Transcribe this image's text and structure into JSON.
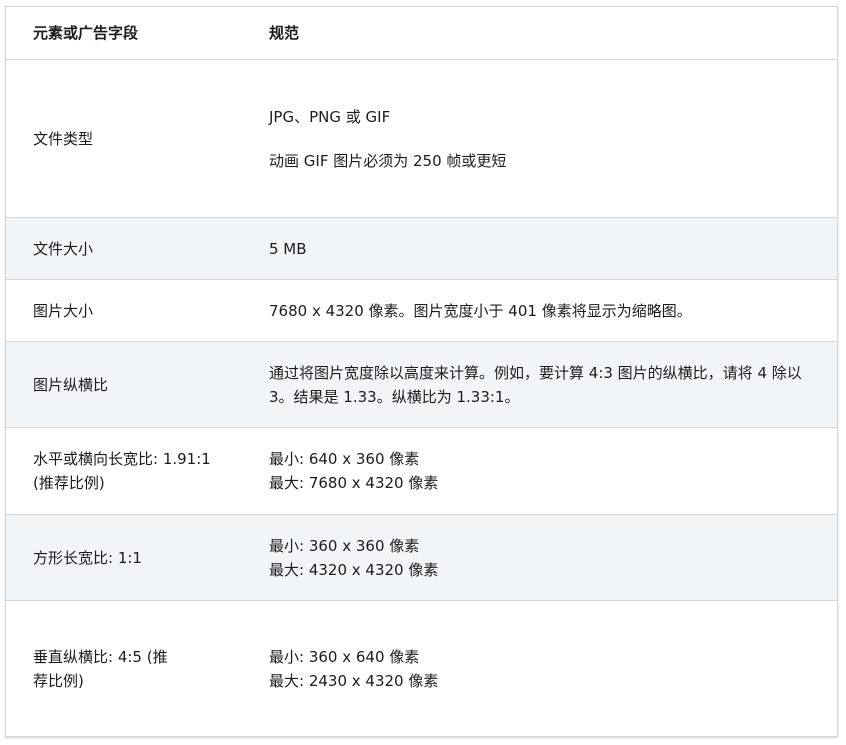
{
  "header": {
    "col1": "元素或广告字段",
    "col2": "规范"
  },
  "rows": [
    {
      "field": "文件类型",
      "spec": [
        "JPG、PNG 或 GIF",
        "动画 GIF 图片必须为 250 帧或更短"
      ]
    },
    {
      "field": "文件大小",
      "spec": [
        "5 MB"
      ]
    },
    {
      "field": "图片大小",
      "spec": [
        "7680 x 4320 像素。图片宽度小于 401 像素将显示为缩略图。"
      ]
    },
    {
      "field": "图片纵横比",
      "spec": [
        "通过将图片宽度除以高度来计算。例如，要计算 4:3 图片的纵横比，请将 4 除以 3。结果是 1.33。纵横比为 1.33:1。"
      ]
    },
    {
      "field": "水平或横向长宽比: 1.91:1 (推荐比例)",
      "spec": [
        "最小: 640 x 360 像素",
        "最大: 7680 x 4320 像素"
      ]
    },
    {
      "field": "方形长宽比: 1:1",
      "spec": [
        "最小: 360 x 360 像素",
        "最大: 4320 x 4320 像素"
      ]
    },
    {
      "field": "垂直纵横比: 4:5 (推荐比例)",
      "spec": [
        "最小: 360 x 640 像素",
        "最大: 2430 x 4320 像素"
      ]
    }
  ]
}
